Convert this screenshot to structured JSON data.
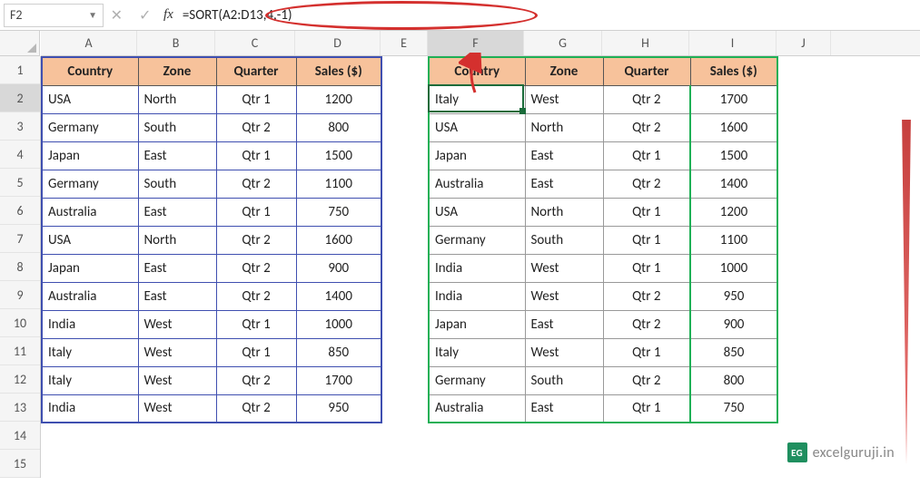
{
  "nameBox": "F2",
  "formula": "=SORT(A2:D13,4,-1)",
  "columns": [
    "A",
    "B",
    "C",
    "D",
    "E",
    "F",
    "G",
    "H",
    "I",
    "J"
  ],
  "rows": [
    "1",
    "2",
    "3",
    "4",
    "5",
    "6",
    "7",
    "8",
    "9",
    "10",
    "11",
    "12",
    "13",
    "14",
    "15"
  ],
  "headers": [
    "Country",
    "Zone",
    "Quarter",
    "Sales ($)"
  ],
  "table1": [
    [
      "USA",
      "North",
      "Qtr 1",
      "1200"
    ],
    [
      "Germany",
      "South",
      "Qtr 2",
      "800"
    ],
    [
      "Japan",
      "East",
      "Qtr 1",
      "1500"
    ],
    [
      "Germany",
      "South",
      "Qtr 2",
      "1100"
    ],
    [
      "Australia",
      "East",
      "Qtr 1",
      "750"
    ],
    [
      "USA",
      "North",
      "Qtr 2",
      "1600"
    ],
    [
      "Japan",
      "East",
      "Qtr 2",
      "900"
    ],
    [
      "Australia",
      "East",
      "Qtr 2",
      "1400"
    ],
    [
      "India",
      "West",
      "Qtr 1",
      "1000"
    ],
    [
      "Italy",
      "West",
      "Qtr 1",
      "850"
    ],
    [
      "Italy",
      "West",
      "Qtr 2",
      "1700"
    ],
    [
      "India",
      "West",
      "Qtr 2",
      "950"
    ]
  ],
  "table2": [
    [
      "Italy",
      "West",
      "Qtr 2",
      "1700"
    ],
    [
      "USA",
      "North",
      "Qtr 2",
      "1600"
    ],
    [
      "Japan",
      "East",
      "Qtr 1",
      "1500"
    ],
    [
      "Australia",
      "East",
      "Qtr 2",
      "1400"
    ],
    [
      "USA",
      "North",
      "Qtr 1",
      "1200"
    ],
    [
      "Germany",
      "South",
      "Qtr 1",
      "1100"
    ],
    [
      "India",
      "West",
      "Qtr 1",
      "1000"
    ],
    [
      "India",
      "West",
      "Qtr 2",
      "950"
    ],
    [
      "Japan",
      "East",
      "Qtr 2",
      "900"
    ],
    [
      "Italy",
      "West",
      "Qtr 1",
      "850"
    ],
    [
      "Germany",
      "South",
      "Qtr 2",
      "800"
    ],
    [
      "Australia",
      "East",
      "Qtr 1",
      "750"
    ]
  ],
  "watermark": {
    "badge": "EG",
    "text": "excelguruji.in"
  },
  "chart_data": {
    "type": "table",
    "title": "SORT formula demo: sort A2:D13 by column 4 descending",
    "source_range": "A2:D13",
    "sort_index": 4,
    "sort_order": -1,
    "columns": [
      "Country",
      "Zone",
      "Quarter",
      "Sales ($)"
    ],
    "input_rows": [
      [
        "USA",
        "North",
        "Qtr 1",
        1200
      ],
      [
        "Germany",
        "South",
        "Qtr 2",
        800
      ],
      [
        "Japan",
        "East",
        "Qtr 1",
        1500
      ],
      [
        "Germany",
        "South",
        "Qtr 2",
        1100
      ],
      [
        "Australia",
        "East",
        "Qtr 1",
        750
      ],
      [
        "USA",
        "North",
        "Qtr 2",
        1600
      ],
      [
        "Japan",
        "East",
        "Qtr 2",
        900
      ],
      [
        "Australia",
        "East",
        "Qtr 2",
        1400
      ],
      [
        "India",
        "West",
        "Qtr 1",
        1000
      ],
      [
        "Italy",
        "West",
        "Qtr 1",
        850
      ],
      [
        "Italy",
        "West",
        "Qtr 2",
        1700
      ],
      [
        "India",
        "West",
        "Qtr 2",
        950
      ]
    ],
    "output_rows": [
      [
        "Italy",
        "West",
        "Qtr 2",
        1700
      ],
      [
        "USA",
        "North",
        "Qtr 2",
        1600
      ],
      [
        "Japan",
        "East",
        "Qtr 1",
        1500
      ],
      [
        "Australia",
        "East",
        "Qtr 2",
        1400
      ],
      [
        "USA",
        "North",
        "Qtr 1",
        1200
      ],
      [
        "Germany",
        "South",
        "Qtr 1",
        1100
      ],
      [
        "India",
        "West",
        "Qtr 1",
        1000
      ],
      [
        "India",
        "West",
        "Qtr 2",
        950
      ],
      [
        "Japan",
        "East",
        "Qtr 2",
        900
      ],
      [
        "Italy",
        "West",
        "Qtr 1",
        850
      ],
      [
        "Germany",
        "South",
        "Qtr 2",
        800
      ],
      [
        "Australia",
        "East",
        "Qtr 1",
        750
      ]
    ]
  }
}
